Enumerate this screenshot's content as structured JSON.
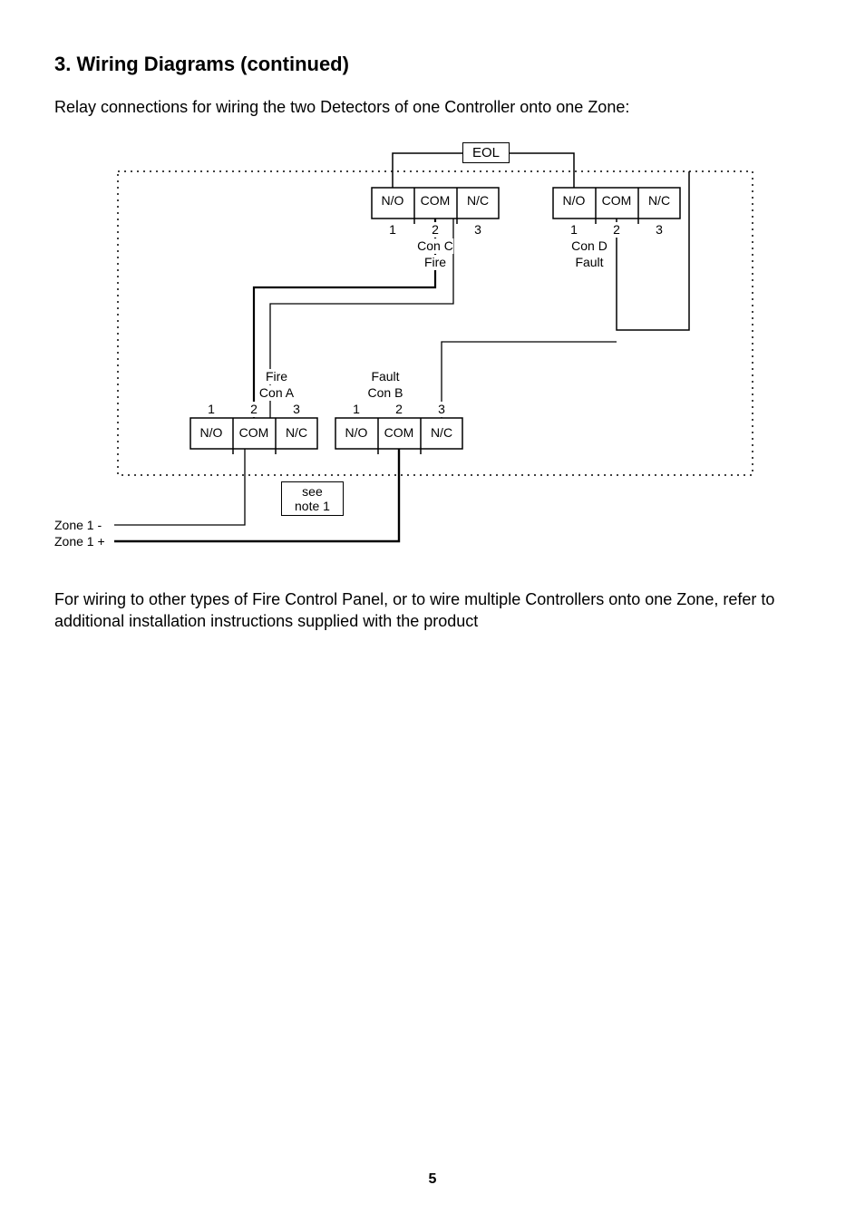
{
  "section_title": "3. Wiring Diagrams (continued)",
  "intro_text": "Relay connections for wiring the two Detectors of one Controller onto one Zone:",
  "outro_text": "For wiring to other types of Fire Control Panel, or to wire multiple Controllers onto one Zone, refer to additional installation instructions supplied with the product",
  "page_number": "5",
  "diagram": {
    "eol_label": "EOL",
    "zone_minus": "Zone 1  -",
    "zone_plus": "Zone 1 +",
    "note_line1": "see",
    "note_line2": "note 1",
    "relays": {
      "conA": {
        "name_line1": "Fire",
        "name_line2": "Con A",
        "terminals": [
          "1",
          "2",
          "3"
        ],
        "pins": [
          "N/O",
          "COM",
          "N/C"
        ]
      },
      "conB": {
        "name_line1": "Fault",
        "name_line2": "Con B",
        "terminals": [
          "1",
          "2",
          "3"
        ],
        "pins": [
          "N/O",
          "COM",
          "N/C"
        ]
      },
      "conC": {
        "name_line1": "Con C",
        "name_line2": "Fire",
        "terminals": [
          "1",
          "2",
          "3"
        ],
        "pins": [
          "N/O",
          "COM",
          "N/C"
        ]
      },
      "conD": {
        "name_line1": "Con D",
        "name_line2": "Fault",
        "terminals": [
          "1",
          "2",
          "3"
        ],
        "pins": [
          "N/O",
          "COM",
          "N/C"
        ]
      }
    }
  }
}
